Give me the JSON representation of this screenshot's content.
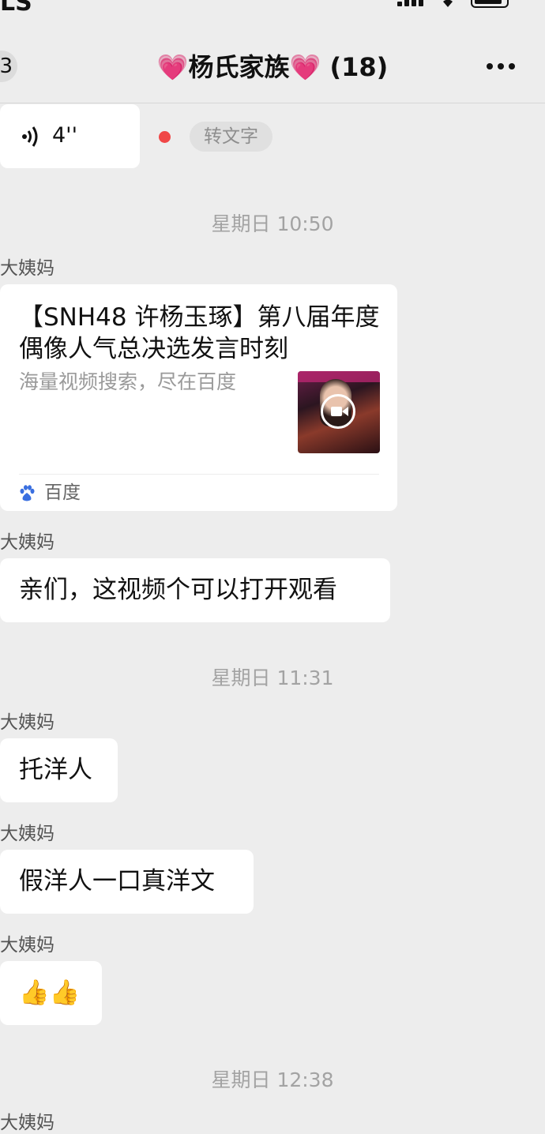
{
  "status_bar": {
    "left_text": "LS"
  },
  "header": {
    "back_badge": "3",
    "title": "💗杨氏家族💗 (18)"
  },
  "voice_message": {
    "duration": "4''",
    "convert_label": "转文字"
  },
  "timestamps": [
    "星期日 10:50",
    "星期日 11:31",
    "星期日 12:38"
  ],
  "card": {
    "sender": "大姨妈",
    "title": "【SNH48 许杨玉琢】第八届年度偶像人气总决选发言时刻",
    "desc": "海量视频搜索，尽在百度",
    "source": "百度"
  },
  "messages": [
    {
      "sender": "大姨妈",
      "text": "亲们，这视频个可以打开观看"
    },
    {
      "sender": "大姨妈",
      "text": "托洋人"
    },
    {
      "sender": "大姨妈",
      "text": "假洋人一口真洋文"
    },
    {
      "sender": "大姨妈",
      "text": "👍👍"
    }
  ],
  "last_sender": "大姨妈"
}
